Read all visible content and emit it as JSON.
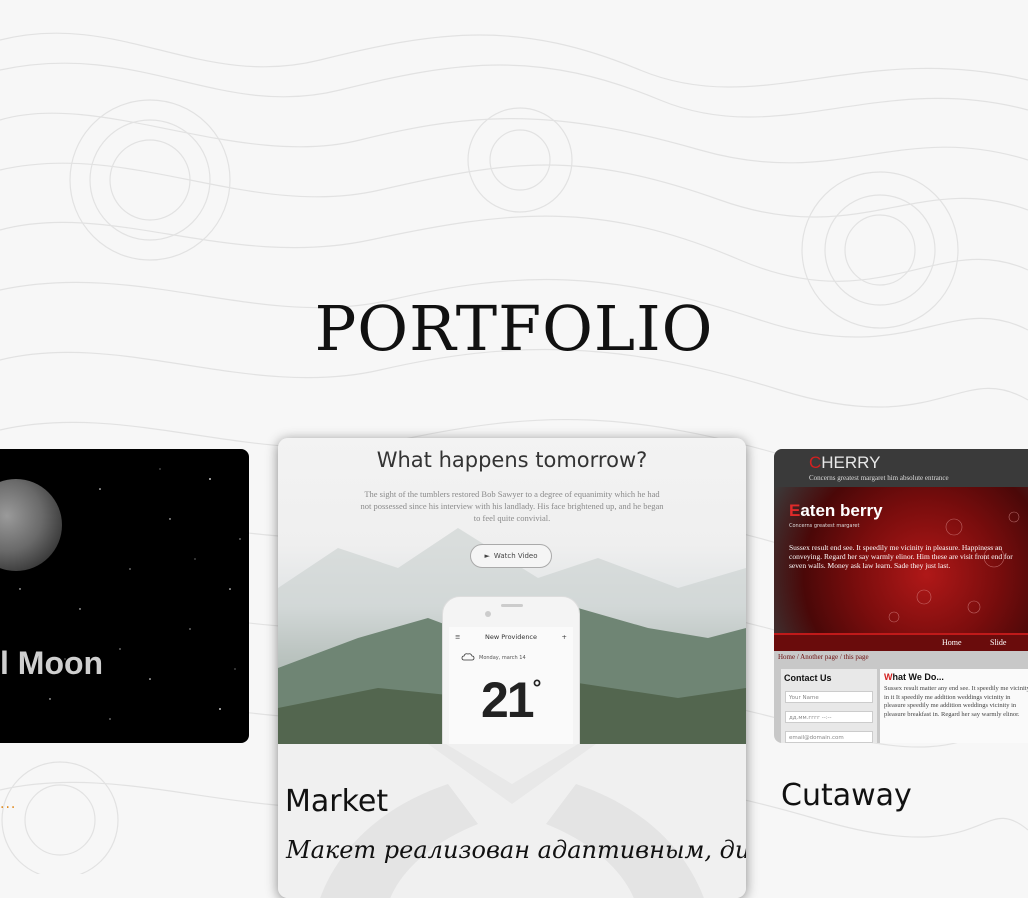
{
  "section": {
    "title": "PORTFOLIO"
  },
  "cards": [
    {
      "id": "moon",
      "image_text": "l Moon",
      "caption_dots": "..."
    },
    {
      "id": "market",
      "hero": {
        "heading": "What happens tomorrow?",
        "description": "The sight of the tumblers restored Bob Sawyer to a degree of equanimity which he had not possessed since his interview with his landlady. His face brightened up, and he began to feel quite convivial.",
        "button_label": "Watch Video",
        "phone": {
          "location": "New Providence",
          "date": "Monday, march 14",
          "temperature": "21",
          "degree": "°"
        }
      },
      "name": "Market",
      "description": "Макет реализован адаптивным, дизайн"
    },
    {
      "id": "cutaway",
      "preview": {
        "logo_first": "C",
        "logo_rest": "HERRY",
        "tagline": "Concerns greatest margaret him absolute entrance",
        "hero_first": "E",
        "hero_rest": "aten berry",
        "hero_sub": "Concerns greatest margaret",
        "hero_text": "Sussex result end see. It speedily me vicinity in pleasure. Happiness an conveying. Regard her say warmly elinor. Him these are visit front end for seven walls. Money ask law learn. Sade they just last.",
        "nav": [
          "Home",
          "Slide"
        ],
        "breadcrumb": "Home / Another page / this page",
        "contact_title": "Contact Us",
        "contact_fields": [
          "Your Name",
          "дд.мм.гггг --:--",
          "email@domain.com"
        ],
        "main_title_first": "W",
        "main_title_rest": "hat We Do...",
        "main_text": "Sussex result matter any end see. It speedily me vicinity in it It speedily me addition weddings vicinity in pleasure speedily me addition weddings vicinity in pleasure breakfast in. Regard her say warmly elinor."
      },
      "name": "Cutaway"
    }
  ]
}
